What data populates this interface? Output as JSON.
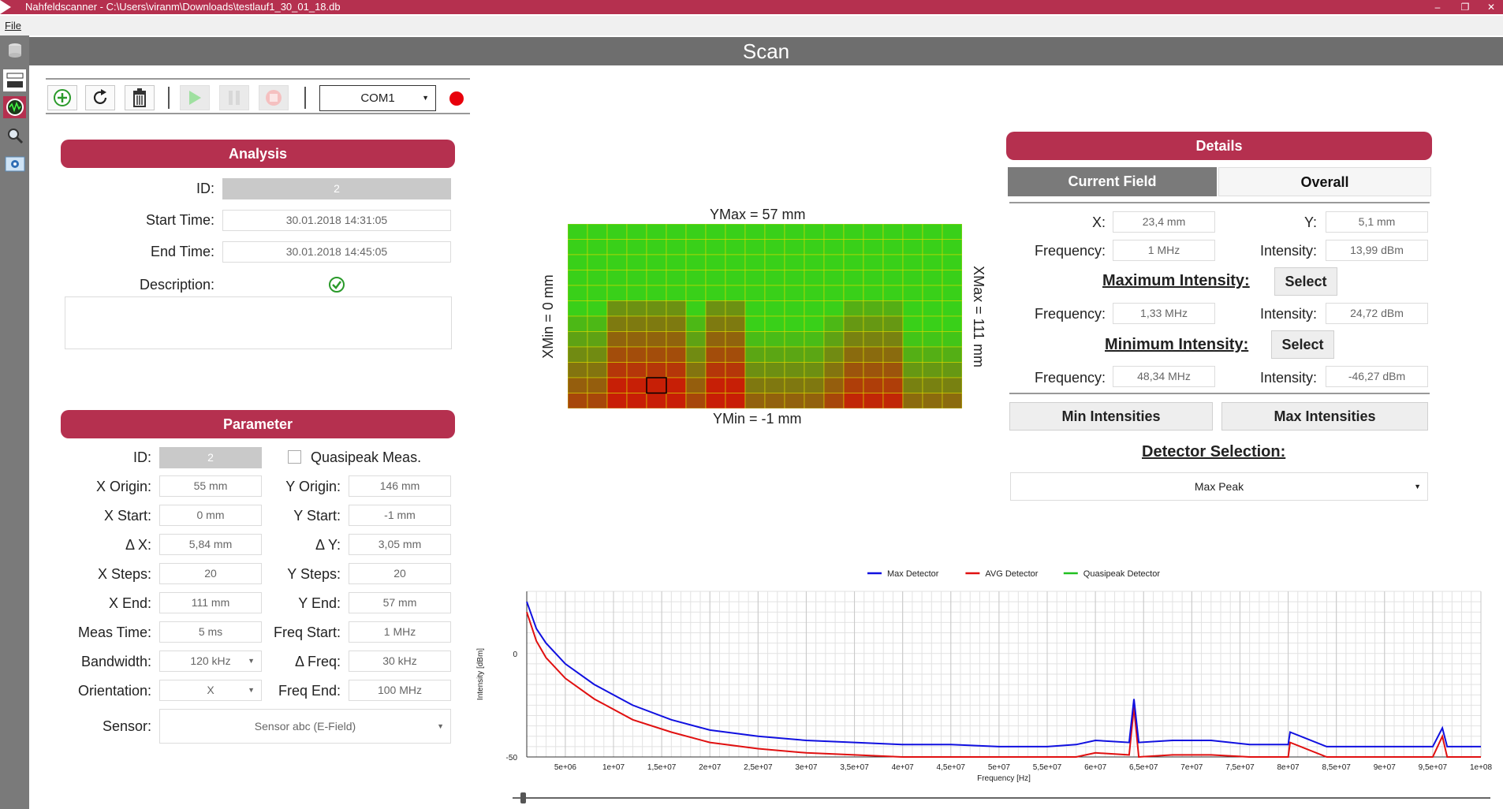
{
  "window": {
    "title": "Nahfeldscanner - C:\\Users\\viranm\\Downloads\\testlauf1_30_01_18.db",
    "minimize": "‒",
    "restore": "❐",
    "close": "✕"
  },
  "menu": {
    "file": "File"
  },
  "page": {
    "title": "Scan"
  },
  "toolbar": {
    "com_port": "COM1",
    "status_color": "#e8000b"
  },
  "analysis": {
    "header": "Analysis",
    "id_label": "ID:",
    "id_value": "2",
    "start_label": "Start Time:",
    "start_value": "30.01.2018 14:31:05",
    "end_label": "End Time:",
    "end_value": "30.01.2018 14:45:05",
    "description_label": "Description:",
    "description_value": ""
  },
  "parameter": {
    "header": "Parameter",
    "id_label": "ID:",
    "id_value": "2",
    "quasipeak_label": "Quasipeak Meas.",
    "x_origin_label": "X Origin:",
    "x_origin": "55 mm",
    "y_origin_label": "Y Origin:",
    "y_origin": "146 mm",
    "x_start_label": "X Start:",
    "x_start": "0 mm",
    "y_start_label": "Y Start:",
    "y_start": "-1 mm",
    "dx_label": "Δ X:",
    "dx": "5,84 mm",
    "dy_label": "Δ Y:",
    "dy": "3,05 mm",
    "x_steps_label": "X Steps:",
    "x_steps": "20",
    "y_steps_label": "Y Steps:",
    "y_steps": "20",
    "x_end_label": "X End:",
    "x_end": "111 mm",
    "y_end_label": "Y End:",
    "y_end": "57 mm",
    "meas_time_label": "Meas Time:",
    "meas_time": "5 ms",
    "freq_start_label": "Freq Start:",
    "freq_start": "1 MHz",
    "bandwidth_label": "Bandwidth:",
    "bandwidth": "120 kHz",
    "dfreq_label": "Δ Freq:",
    "dfreq": "30 kHz",
    "orientation_label": "Orientation:",
    "orientation": "X",
    "freq_end_label": "Freq End:",
    "freq_end": "100 MHz",
    "sensor_label": "Sensor:",
    "sensor": "Sensor abc  (E-Field)"
  },
  "heatmap": {
    "ymax_label": "YMax = 57 mm",
    "ymin_label": "YMin = -1 mm",
    "xmin_label": "XMin = 0 mm",
    "xmax_label": "XMax = 111 mm",
    "columns": 20,
    "rows": 12,
    "color_low": "#39d019",
    "color_high": "#c81e06",
    "selected_cell": [
      4,
      10
    ]
  },
  "details": {
    "header": "Details",
    "tab_current": "Current Field",
    "tab_overall": "Overall",
    "x_label": "X:",
    "x_value": "23,4 mm",
    "y_label": "Y:",
    "y_value": "5,1 mm",
    "freq_label": "Frequency:",
    "freq_value": "1 MHz",
    "int_label": "Intensity:",
    "int_value": "13,99 dBm",
    "max_title": "Maximum Intensity:",
    "max_select": "Select",
    "max_freq_label": "Frequency:",
    "max_freq": "1,33 MHz",
    "max_int_label": "Intensity:",
    "max_int": "24,72 dBm",
    "min_title": "Minimum Intensity:",
    "min_select": "Select",
    "min_freq_label": "Frequency:",
    "min_freq": "48,34 MHz",
    "min_int_label": "Intensity:",
    "min_int": "-46,27 dBm",
    "min_intensities_btn": "Min Intensities",
    "max_intensities_btn": "Max Intensities",
    "detector_title": "Detector Selection:",
    "detector_value": "Max Peak"
  },
  "chart_data": {
    "type": "line",
    "xlabel": "Frequency [Hz]",
    "ylabel": "Intensity [dBm]",
    "xlim": [
      1000000,
      100000000
    ],
    "ylim": [
      -50,
      30
    ],
    "x_ticks": [
      "5e+06",
      "1e+07",
      "1,5e+07",
      "2e+07",
      "2,5e+07",
      "3e+07",
      "3,5e+07",
      "4e+07",
      "4,5e+07",
      "5e+07",
      "5,5e+07",
      "6e+07",
      "6,5e+07",
      "7e+07",
      "7,5e+07",
      "8e+07",
      "8,5e+07",
      "9e+07",
      "9,5e+07",
      "1e+08"
    ],
    "y_ticks": [
      "0",
      "-50"
    ],
    "legend_position": "top-center",
    "grid": true,
    "series": [
      {
        "name": "Max Detector",
        "color": "#1010e0",
        "x": [
          1000000,
          2000000,
          3000000,
          5000000,
          8000000,
          12000000,
          16000000,
          20000000,
          25000000,
          30000000,
          35000000,
          40000000,
          45000000,
          50000000,
          55000000,
          58000000,
          60000000,
          63500000,
          64000000,
          64500000,
          68000000,
          72000000,
          76000000,
          80000000,
          80200000,
          84000000,
          90000000,
          95000000,
          96000000,
          96500000,
          100000000
        ],
        "y": [
          25,
          12,
          5,
          -5,
          -15,
          -25,
          -32,
          -37,
          -40,
          -42,
          -43,
          -44,
          -44,
          -45,
          -45,
          -44,
          -42,
          -43,
          -22,
          -43,
          -42,
          -42,
          -44,
          -44,
          -38,
          -45,
          -45,
          -45,
          -36,
          -45,
          -45
        ]
      },
      {
        "name": "AVG Detector",
        "color": "#e01010",
        "x": [
          1000000,
          2000000,
          3000000,
          5000000,
          8000000,
          12000000,
          16000000,
          20000000,
          25000000,
          30000000,
          35000000,
          40000000,
          45000000,
          50000000,
          55000000,
          58000000,
          60000000,
          63500000,
          64000000,
          64500000,
          68000000,
          72000000,
          76000000,
          80000000,
          80200000,
          84000000,
          90000000,
          95000000,
          96000000,
          96500000,
          100000000
        ],
        "y": [
          20,
          6,
          -2,
          -12,
          -22,
          -32,
          -38,
          -43,
          -46,
          -48,
          -49,
          -50,
          -50,
          -50,
          -50,
          -50,
          -48,
          -49,
          -26,
          -50,
          -49,
          -49,
          -50,
          -50,
          -43,
          -50,
          -50,
          -50,
          -40,
          -50,
          -50
        ]
      },
      {
        "name": "Quasipeak Detector",
        "color": "#20c020",
        "x": [],
        "y": []
      }
    ]
  }
}
